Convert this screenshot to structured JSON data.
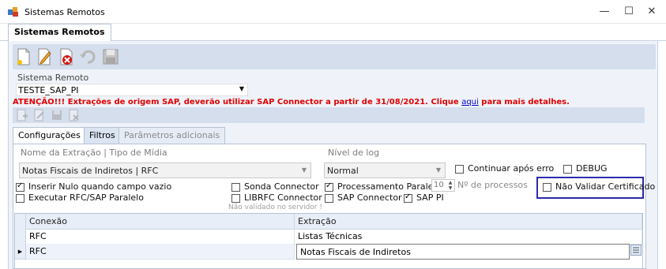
{
  "window": {
    "title": "Sistemas Remotos",
    "minimize_glyph": "—",
    "maximize_glyph": "☐",
    "close_glyph": "✕"
  },
  "document_tab": {
    "label": "Sistemas Remotos"
  },
  "toolbar": {
    "icons": [
      "new-document-icon",
      "edit-icon",
      "delete-icon",
      "undo-icon",
      "save-icon"
    ]
  },
  "sistema_remoto": {
    "label": "Sistema Remoto",
    "value": "TESTE_SAP_PI"
  },
  "warning": {
    "text": "ATENÇÃO!!! Extrações de origem SAP, deverão utilizar SAP Connector a partir de 31/08/2021. Clique",
    "link": "aqui",
    "suffix": "para mais detalhes."
  },
  "toolbar2": {
    "icons": [
      "add-icon",
      "edit-icon",
      "save-icon",
      "delete-icon"
    ]
  },
  "tabs": [
    {
      "label": "Configurações",
      "active": true
    },
    {
      "label": "Filtros",
      "active": false
    },
    {
      "label": "Parâmetros adicionais",
      "active": false,
      "disabled": true
    }
  ],
  "config": {
    "extracao_label": "Nome da Extração | Tipo de Mídia",
    "extracao_value": "Notas Fiscais de Indiretos | RFC",
    "nivel_log_label": "Nível de log",
    "nivel_log_value": "Normal",
    "checkboxes": {
      "continuar_apos_erro": {
        "label": "Continuar após erro",
        "checked": false
      },
      "debug": {
        "label": "DEBUG",
        "checked": false
      },
      "inserir_nulo": {
        "label": "Inserir Nulo quando campo vazio",
        "checked": true
      },
      "executar_rfc_paralelo": {
        "label": "Executar RFC/SAP Paralelo",
        "checked": false
      },
      "sonda_connector": {
        "label": "Sonda Connector",
        "checked": false
      },
      "librfc_connector": {
        "label": "LIBRFC Connector",
        "checked": false
      },
      "processamento_paralelo": {
        "label": "Processamento Paralelo",
        "checked": true
      },
      "sap_connector": {
        "label": "SAP Connector",
        "checked": false
      },
      "sap_pi": {
        "label": "SAP PI",
        "checked": true
      },
      "nao_validar_certificado": {
        "label": "Não Validar Certificado",
        "checked": false
      }
    },
    "processos_value": "10",
    "processos_label": "Nº de processos",
    "note": "Não validado no servidor !"
  },
  "grid": {
    "columns": [
      "Conexão",
      "Extração"
    ],
    "rows": [
      {
        "conexao": "RFC",
        "extracao": "Listas Técnicas"
      },
      {
        "conexao": "RFC",
        "extracao": "Notas Fiscais de Indiretos"
      }
    ]
  }
}
